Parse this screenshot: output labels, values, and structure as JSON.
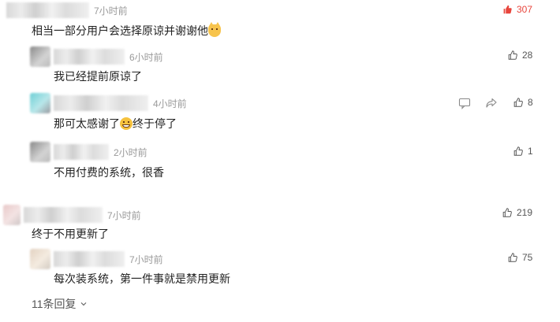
{
  "comments": [
    {
      "time": "7小时前",
      "text": "相当一部分用户会选择原谅并谢谢他",
      "emoji": "cat-emoji",
      "likes": "307",
      "liked": true,
      "replies": [
        {
          "time": "6小时前",
          "text": "我已经提前原谅了",
          "likes": "28"
        },
        {
          "time": "4小时前",
          "text_before": "那可太感谢了",
          "emoji": "grin-emoji",
          "text_after": "终于停了",
          "likes": "8"
        },
        {
          "time": "2小时前",
          "text": "不用付费的系统，很香",
          "likes": "1"
        }
      ]
    },
    {
      "time": "7小时前",
      "text": "终于不用更新了",
      "likes": "219",
      "replies": [
        {
          "time": "7小时前",
          "text": "每次装系统，第一件事就是禁用更新",
          "likes": "75"
        }
      ],
      "more_replies": "11条回复"
    }
  ],
  "icons": {
    "like": "thumbs-up-icon",
    "liked": "heart-like-icon",
    "comment": "comment-icon",
    "share": "share-icon",
    "expand": "chevron-down-icon"
  },
  "colors": {
    "hot_like": "#e8453c",
    "time": "#9a9a9a"
  }
}
